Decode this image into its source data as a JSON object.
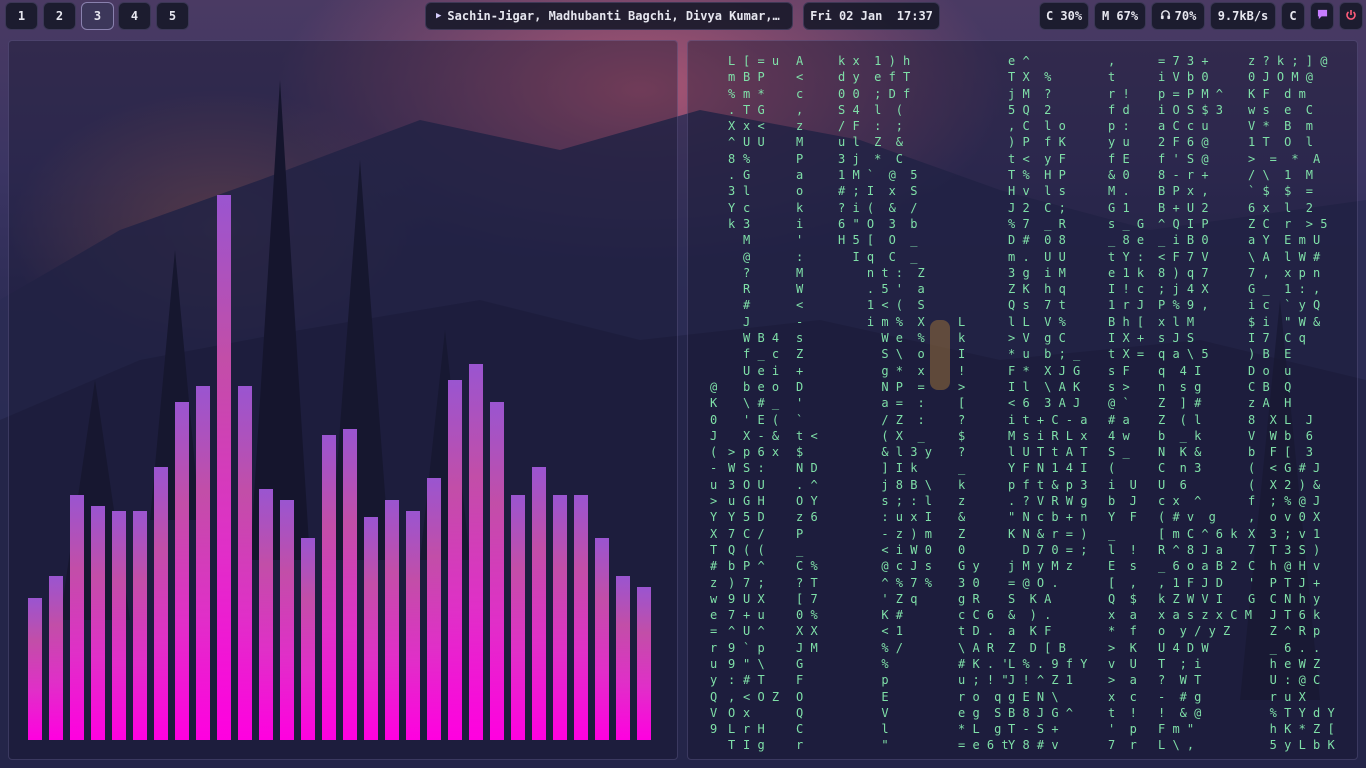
{
  "workspaces": [
    {
      "label": "1",
      "active": false
    },
    {
      "label": "2",
      "active": false
    },
    {
      "label": "3",
      "active": true
    },
    {
      "label": "4",
      "active": false
    },
    {
      "label": "5",
      "active": false
    }
  ],
  "media": {
    "title": "Sachin-Jigar, Madhubanti Bagchi, Divya Kumar, A..."
  },
  "clock": {
    "text": "Fri 02 Jan  17:37"
  },
  "status": {
    "cpu": "C 30%",
    "memory": "M 67%",
    "volume": "70%",
    "network": "9.7kB/s",
    "clipboard": "C"
  },
  "icons": {
    "play": "play-icon",
    "headphones": "headphones-icon",
    "notification": "notification-icon",
    "power": "power-icon"
  },
  "colors": {
    "accent": "#c77dff",
    "matrix_text": "#7fe0a8",
    "bar_bottom": "#ff00e0",
    "bar_top": "#9a55d0",
    "power": "#ff5c7a"
  },
  "visualizer": {
    "levels": [
      0.26,
      0.3,
      0.45,
      0.43,
      0.42,
      0.42,
      0.5,
      0.62,
      0.65,
      1.0,
      0.65,
      0.46,
      0.44,
      0.37,
      0.56,
      0.57,
      0.41,
      0.44,
      0.42,
      0.48,
      0.66,
      0.69,
      0.62,
      0.45,
      0.5,
      0.45,
      0.45,
      0.37,
      0.3,
      0.28
    ]
  },
  "matrix": {
    "columns": [
      "\n\n\n\n\n\n\n\n\n\n\n\n\n\n\n\n\n\n\n\n@\nK\n0\nJ\n(\n-\nu\n>\nY\nX\nT\n#\nz\nw\ne\n=\nr\nu\ny\nQ\nV\n9",
      "L\nm\n%\n.\nX\n^\n8\n.\n3\nY\nk\n\n\n\n\n\n\n\n\n\n\n\n\n\n>\nW\n3\nu\nY\n7\nQ\nb\n)\n9\n7\n^\n9\n9\n:\n,\nO\nL\nT",
      "[ = u\nB P\nm *\nT G\nx <\nU U\n%\nG\nl\nc\n3\nM\n@\n?\nR\n#\nJ\nW B 4\nf _ c\nU e i\nb e o\n\\ # _\n' E (\nX - &\np 6 x\nS :\nO U\nG H\n5 D\nC /\n( (\nP ^\n7 ;\nU X\n+ u\nU ^\n` p\n\" \\\n# T\n< O Z\nx\nr H\nI g",
      "A\n<\nc\n,\nz\nM\nP\na\no\nk\ni\n'\n:\nM\nW\n<\n-\ns\nZ\n+\nD\n'\n`\nt <\n$\nN D\n. ^\nO Y\nz 6\nP\n_\nC %\n? T\n[ 7\n0 %\nX X\nJ M\nG\nF\nO\nQ\nC\nr",
      "k x  1 ) h\nd y  e f T\n0 0  ; D f\nS 4  l  (\n/ F  :  ;\nu l  Z  &\n3 j  *  C\n1 M `  @  5\n# ; I  x  S\n? i (  &  /\n6 \" O  3  b\nH 5 [  O  _\n  I q  C  _\n    n t :  Z\n    . 5 '  a\n    1 < (  S\n    i m %  X\n      W e  %\n      S \\  o\n      g *  x\n      N P  =\n      a =  :\n      / Z  :\n      ( X  _\n      & l 3 y\n      ] I k\n      j 8 B \\\n      s ; : l\n      : u x I\n      - z ) m\n      < i W 0\n      @ c J s\n      ^ % 7 %\n      ' Z q\n      K #\n      < 1\n      % /\n      %\n      p\n      E\n      V\n      l\n      \"",
      "\n\n\n\n\n\n\n\n\n\n\n\n\n\n\n\nL\nk\nI\n!\n>\n[\n?\n$\n?\n_\nk\nz\n&\nZ\n0\nG y\n3 0\ng R\nc C 6\nt D .\n\\ A R\n# K . '\nu ; ! \"\nr o  q\ne g  S\n* L  g\n= e 6 t",
      "e ^\nT X  %\nj M  ?\n5 Q  2\n, C  l o\n) P  f K\nt <  y F\nT %  H P\nH v  l s\nJ 2  C ;\n% 7  _ R\nD #  0 8\nm .  U U\n3 g  i M\nZ K  h q\nQ s  7 t\nl L  V %\n> V  g C\n* u  b ; _\nF *  X J G\nI l  \\ A K\n< 6  3 A J\ni t + C - a\nM s i R L x\nl U T t A T\nY F N 1 4 I\np f t & p 3\n. ? V R W g\n\" N c b + n\nK N & r = )\n  D 7 0 = ;\nj M y M z\n= @ O .\nS  K A\n&  ) .\na  K F\nZ  D [ B\nL % . 9 f Y\nJ ! ^ Z 1\ng E N \\\nB 8 J G ^\nT - S +\nY 8 # v",
      ",\nt\nr !\nf d\np :\ny u\nf E\n& 0\nM .\nG 1\ns _ G\n_ 8 e\nt Y :\ne 1 k\nI ! c\n1 r J\nB h [\nI X +\nt X =\ns F\ns >\n@ `\n# a\n4 w\nS _\n(\ni  U\nb  J\nY  F\n_\nl  !\nE  s\n[  ,\nQ  $\nx  a\n*  f\n>  K\nv  U\n>  a\nx  c\nt  !\n'  p\n7  r",
      "= 7 3 +\ni V b 0\np = P M ^\ni O S $ 3\na C c u\n2 F 6 @\nf ' S @\n8 - r +\nB P x ,\nB + U 2\n^ Q I P\n_ i B 0\n< F 7 V\n8 ) q 7\n; j 4 X\nP % 9 ,\nx l M\ns J S\nq a \\ 5\nq  4 I\nn  s g\nZ  ] #\nZ  ( l\nb  _ k\nN  K &\nC  n 3\nU  6\nc x  ^\n( # v  g\n[ m C ^ 6 k\nR ^ 8 J a\n_ 6 o a B 2\n, 1 F J D\nk Z W V I\nx a s z x C M\no  y / y Z\nU 4 D W\nT  ; i\n?  W T\n-  # g\n!  & @\nF m \"\nL \\ ,",
      "z ? k ; ] @\n0 J O M @\nK F  d m\nw s  e  C\nV *  B  m\n1 T  O  l\n>  =  *  A\n/ \\  1  M\n` $  $  =\n6 x  l  2\nZ C  r  > 5\na Y  E m U\n\\ A  l W #\n7 ,  x p n\nG _  1 : ,\ni c  ` y Q\n$ i  \" W &\nI 7  C q\n) B  E\nD o  u\nC B  Q\nz A  H\n8  X L  J\nV  W b  6\nb  F [  3\n(  < G # J\n(  X 2 ) &\nf  ; % @ J\n,  o v 0 X\nX  3 ; v 1\n7  T 3 S )\nC  h @ H v\n'  P T J +\nG  C N h y\n   J T 6 k\n   Z ^ R p\n   _ 6 . .\n   h e W Z\n   U : @ C\n   r u X\n   % T Y d Y\n   h K * Z [\n   5 y L b K"
    ]
  }
}
